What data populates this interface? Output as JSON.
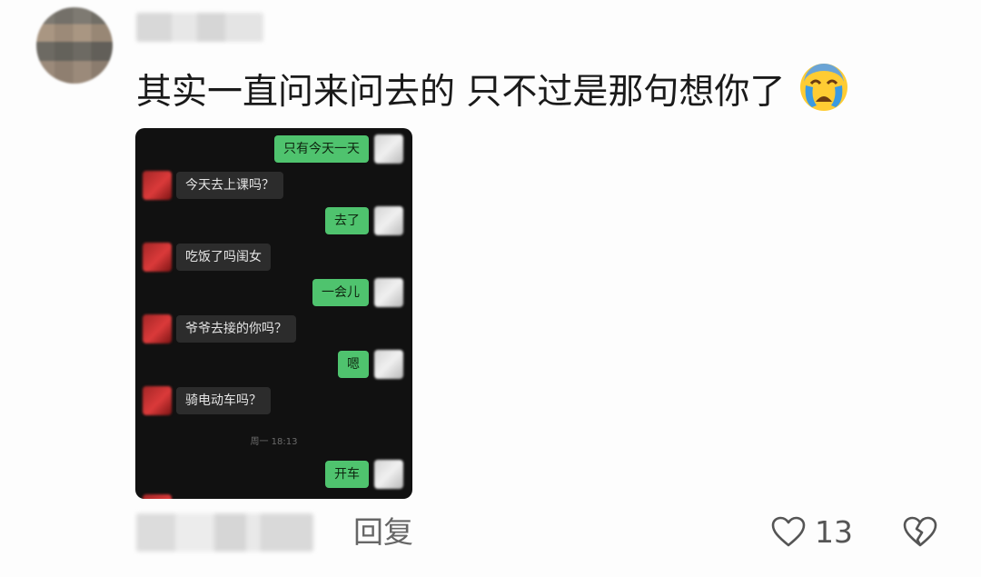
{
  "comment": {
    "text": "其实一直问来问去的 只不过是那句想你了",
    "emoji": "loudly-crying-face"
  },
  "chat": {
    "messages": [
      {
        "side": "out",
        "text": "只有今天一天"
      },
      {
        "side": "in",
        "text": "今天去上课吗？"
      },
      {
        "side": "out",
        "text": "去了"
      },
      {
        "side": "in",
        "text": "吃饭了吗闺女"
      },
      {
        "side": "out",
        "text": "一会儿"
      },
      {
        "side": "in",
        "text": "爷爷去接的你吗？"
      },
      {
        "side": "out",
        "text": "嗯"
      },
      {
        "side": "in",
        "text": "骑电动车吗？"
      },
      {
        "side": "out",
        "text": "开车"
      }
    ],
    "timestamp": "周一 18:13"
  },
  "actions": {
    "reply_label": "回复",
    "like_count": "13"
  },
  "colors": {
    "chat_background": "#111111",
    "outgoing_bubble": "#4fc36e",
    "incoming_bubble": "#2c2c2c"
  }
}
